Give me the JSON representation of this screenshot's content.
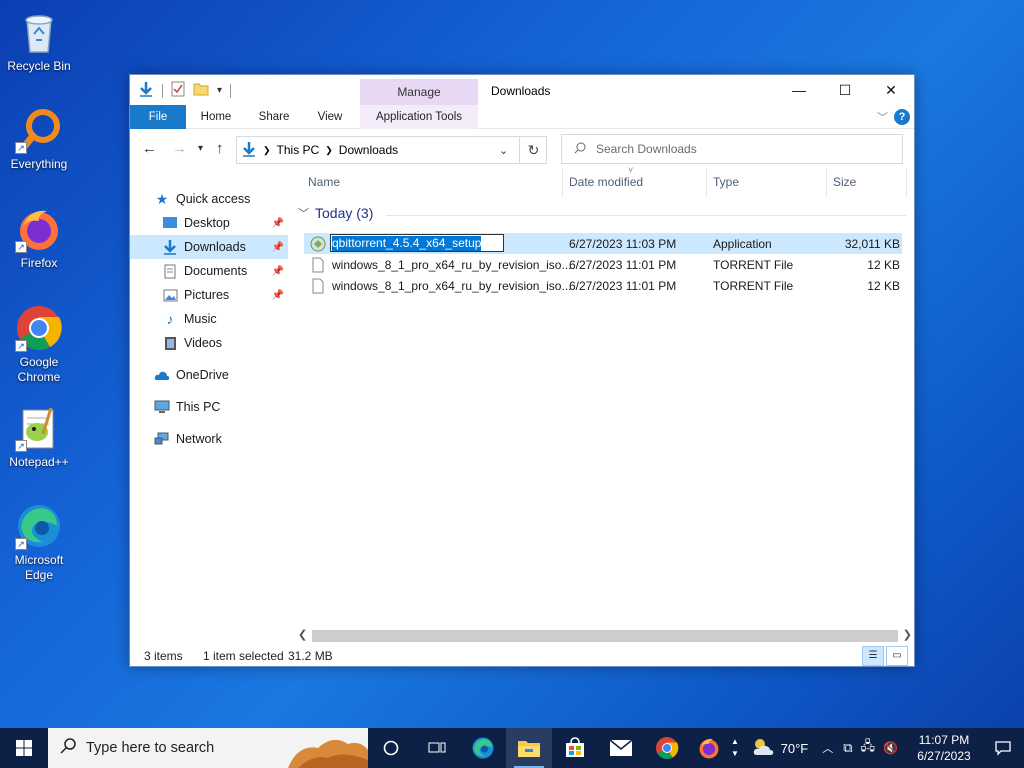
{
  "desktop": {
    "icons": [
      {
        "label": "Recycle Bin"
      },
      {
        "label": "Everything"
      },
      {
        "label": "Firefox"
      },
      {
        "label": "Google Chrome"
      },
      {
        "label": "Notepad++"
      },
      {
        "label": "Microsoft Edge"
      }
    ]
  },
  "window": {
    "title": "Downloads",
    "manage_tab": "Manage",
    "ribbon_tabs": {
      "file": "File",
      "home": "Home",
      "share": "Share",
      "view": "View",
      "app_tools": "Application Tools"
    },
    "address": {
      "crumb1": "This PC",
      "crumb2": "Downloads"
    },
    "search_placeholder": "Search Downloads",
    "nav": {
      "quick_access": "Quick access",
      "desktop": "Desktop",
      "downloads": "Downloads",
      "documents": "Documents",
      "pictures": "Pictures",
      "music": "Music",
      "videos": "Videos",
      "onedrive": "OneDrive",
      "this_pc": "This PC",
      "network": "Network"
    },
    "columns": {
      "name": "Name",
      "date": "Date modified",
      "type": "Type",
      "size": "Size"
    },
    "group_label": "Today (3)",
    "files": [
      {
        "name": "qbittorrent_4.5.4_x64_setup",
        "date": "6/27/2023 11:03 PM",
        "type": "Application",
        "size": "32,011 KB"
      },
      {
        "name": "windows_8_1_pro_x64_ru_by_revision_iso...",
        "date": "6/27/2023 11:01 PM",
        "type": "TORRENT File",
        "size": "12 KB"
      },
      {
        "name": "windows_8_1_pro_x64_ru_by_revision_iso...",
        "date": "6/27/2023 11:01 PM",
        "type": "TORRENT File",
        "size": "12 KB"
      }
    ],
    "status": {
      "items": "3 items",
      "selected": "1 item selected",
      "size": "31.2 MB"
    }
  },
  "taskbar": {
    "search_placeholder": "Type here to search",
    "weather": "70°F",
    "time": "11:07 PM",
    "date": "6/27/2023"
  },
  "colors": {
    "accent": "#1979ca",
    "selection": "#cce8ff",
    "manage_tab": "#e8d8f4",
    "taskbar": "#0d2045"
  }
}
